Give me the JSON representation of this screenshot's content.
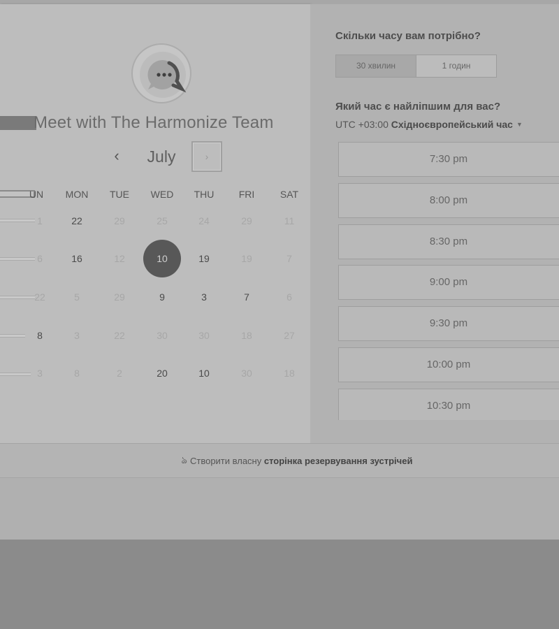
{
  "meeting": {
    "title": "Meet with The Harmonize Team",
    "avatar_icon": "chat-bubble-icon"
  },
  "calendar": {
    "month": "July",
    "prev_icon": "‹",
    "next_icon": "›",
    "days_of_week": [
      "UN",
      "MON",
      "TUE",
      "WED",
      "THU",
      "FRI",
      "SAT"
    ],
    "weeks": [
      [
        {
          "d": "1",
          "state": "dim"
        },
        {
          "d": "22",
          "state": "active"
        },
        {
          "d": "29",
          "state": "dim"
        },
        {
          "d": "25",
          "state": "dim"
        },
        {
          "d": "24",
          "state": "dim"
        },
        {
          "d": "29",
          "state": "dim"
        },
        {
          "d": "11",
          "state": "dim"
        }
      ],
      [
        {
          "d": "6",
          "state": "dim"
        },
        {
          "d": "16",
          "state": "active"
        },
        {
          "d": "12",
          "state": "dim"
        },
        {
          "d": "10",
          "state": "selected"
        },
        {
          "d": "19",
          "state": "active"
        },
        {
          "d": "19",
          "state": "dim"
        },
        {
          "d": "7",
          "state": "dim"
        }
      ],
      [
        {
          "d": "22",
          "state": "dim"
        },
        {
          "d": "5",
          "state": "dim"
        },
        {
          "d": "29",
          "state": "dim"
        },
        {
          "d": "9",
          "state": "active"
        },
        {
          "d": "3",
          "state": "active"
        },
        {
          "d": "7",
          "state": "active"
        },
        {
          "d": "6",
          "state": "dim"
        }
      ],
      [
        {
          "d": "8",
          "state": "active"
        },
        {
          "d": "3",
          "state": "dim"
        },
        {
          "d": "22",
          "state": "dim"
        },
        {
          "d": "30",
          "state": "dim"
        },
        {
          "d": "30",
          "state": "dim"
        },
        {
          "d": "18",
          "state": "dim"
        },
        {
          "d": "27",
          "state": "dim"
        }
      ],
      [
        {
          "d": "3",
          "state": "dim"
        },
        {
          "d": "8",
          "state": "dim"
        },
        {
          "d": "2",
          "state": "dim"
        },
        {
          "d": "20",
          "state": "active"
        },
        {
          "d": "10",
          "state": "active"
        },
        {
          "d": "30",
          "state": "dim"
        },
        {
          "d": "18",
          "state": "dim"
        }
      ]
    ]
  },
  "duration": {
    "heading": "Скільки часу вам потрібно?",
    "options": [
      "30 хвилин",
      "1 годин"
    ],
    "selected": "30 хвилин"
  },
  "time": {
    "heading": "Який час є найліпшим для вас?",
    "timezone_offset": "UTC +03:00",
    "timezone_name": "Східноєвропейський час",
    "slots": [
      "7:30 pm",
      "8:00 pm",
      "8:30 pm",
      "9:00 pm",
      "9:30 pm",
      "10:00 pm",
      "10:30 pm"
    ]
  },
  "footer": {
    "prefix": "Створити власну",
    "link": "сторінка резервування зустрічей",
    "icon": "hubspot-sprocket-icon"
  }
}
